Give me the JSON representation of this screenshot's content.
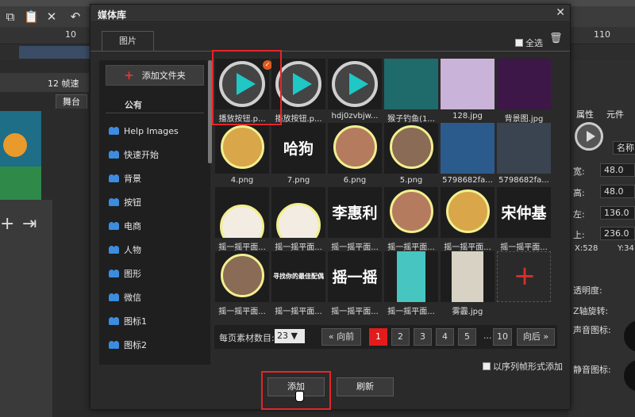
{
  "background": {
    "ruler": {
      "mark_10": "10",
      "mark_110": "110"
    },
    "fps": "12 帧速",
    "stage_tab": "舞台",
    "right_panel": {
      "tab_props": "属性",
      "tab_elements": "元件",
      "name_placeholder": "名称",
      "width_label": "宽:",
      "width_value": "48.0",
      "height_label": "高:",
      "height_value": "48.0",
      "left_label": "左:",
      "left_value": "136.0",
      "top_label": "上:",
      "top_value": "236.0",
      "x_coord": "X:528",
      "y_coord": "Y:34",
      "opacity": "透明度:",
      "zrot": "Z轴旋转:",
      "sound_icon": "声音图标:",
      "mute_icon": "静音图标:"
    }
  },
  "dialog": {
    "title": "媒体库",
    "tab": "图片",
    "select_all": "全选",
    "add_folder": "添加文件夹",
    "public": "公有",
    "folders": [
      "Help Images",
      "快速开始",
      "背景",
      "按钮",
      "电商",
      "人物",
      "图形",
      "微信",
      "图标1",
      "图标2"
    ],
    "items": [
      {
        "caption": "播放按钮.p...",
        "kind": "play",
        "selected": true
      },
      {
        "caption": "播放按钮.p...",
        "kind": "play"
      },
      {
        "caption": "hdj0zvbjw...",
        "kind": "play"
      },
      {
        "caption": "猴子钓鱼(1...",
        "kind": "green"
      },
      {
        "caption": "128.jpg",
        "kind": "couple"
      },
      {
        "caption": "背景图.jpg",
        "kind": "purple"
      },
      {
        "caption": "4.png",
        "kind": "dog"
      },
      {
        "caption": "7.png",
        "kind": "text",
        "text": "哈狗"
      },
      {
        "caption": "6.png",
        "kind": "woman"
      },
      {
        "caption": "5.png",
        "kind": "man"
      },
      {
        "caption": "5798682fa...",
        "kind": "rock"
      },
      {
        "caption": "5798682fa...",
        "kind": "dark"
      },
      {
        "caption": "摇一摇平面...",
        "kind": "partial-top"
      },
      {
        "caption": "摇一摇平面...",
        "kind": "partial-bottom"
      },
      {
        "caption": "摇一摇平面...",
        "kind": "text",
        "text": "李惠利"
      },
      {
        "caption": "摇一摇平面...",
        "kind": "woman"
      },
      {
        "caption": "摇一摇平面...",
        "kind": "dog"
      },
      {
        "caption": "摇一摇平面...",
        "kind": "text",
        "text": "宋仲基"
      },
      {
        "caption": "摇一摇平面...",
        "kind": "man"
      },
      {
        "caption": "摇一摇平面...",
        "kind": "smalltext",
        "text": "寻找你的最佳配偶"
      },
      {
        "caption": "摇一摇平面...",
        "kind": "text",
        "text": "摇一摇"
      },
      {
        "caption": "摇一摇平面...",
        "kind": "teal"
      },
      {
        "caption": "雾霾.jpg",
        "kind": "sketch"
      },
      {
        "caption": "",
        "kind": "add"
      }
    ],
    "pager": {
      "per_page_label": "每页素材数目:",
      "per_page_value": "23 ▼",
      "prev": "« 向前",
      "pages": [
        "1",
        "2",
        "3",
        "4",
        "5"
      ],
      "dots": "...",
      "last": "10",
      "next": "向后 »"
    },
    "seq_add": "以序列帧形式添加",
    "add_button": "添加",
    "refresh_button": "刷新"
  },
  "colors": {
    "accent_red": "#e21b1b",
    "play_teal": "#1fc7c5",
    "folder_blue": "#3c8de0"
  }
}
